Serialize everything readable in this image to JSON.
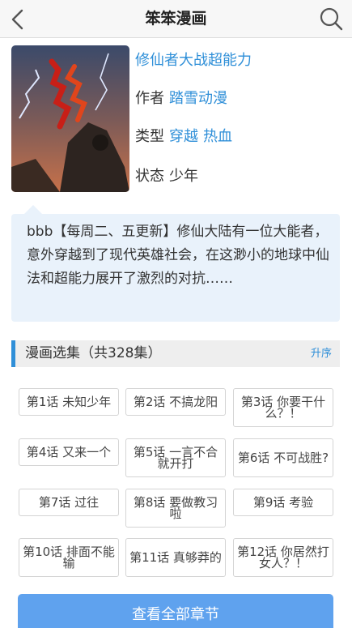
{
  "header": {
    "title": "笨笨漫画",
    "back_icon": "chevron-left-icon",
    "search_icon": "search-icon"
  },
  "book": {
    "title": "修仙者大战超能力",
    "author_label": "作者",
    "author": "踏雪动漫",
    "type_label": "类型",
    "types": [
      "穿越",
      "热血"
    ],
    "status_label": "状态",
    "status": "少年",
    "cover_text": "修仙者大战超能力"
  },
  "description": "bbb【每周二、五更新】修仙大陆有一位大能者，意外穿越到了现代英雄社会，在这渺小的地球中仙法和超能力展开了激烈的对抗……",
  "section": {
    "title": "漫画选集（共328集）",
    "sort_label": "升序"
  },
  "chapters": [
    "第1话 未知少年",
    "第2话 不搞龙阳",
    "第3话 你要干什么？！",
    "第4话 又来一个",
    "第5话 一言不合就开打",
    "第6话 不可战胜?",
    "第7话 过往",
    "第8话 要做教习啦",
    "第9话 考验",
    "第10话 排面不能输",
    "第11话 真够莽的",
    "第12话 你居然打女人？！"
  ],
  "view_all_label": "查看全部章节",
  "colors": {
    "accent": "#2f8fd8",
    "button": "#5fa2ee",
    "description_bg": "#e9f2fb"
  }
}
